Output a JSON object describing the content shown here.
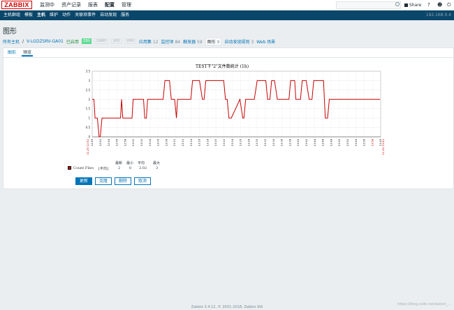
{
  "header": {
    "logo": "ZABBIX",
    "menu": [
      "监测中",
      "资产记录",
      "报表",
      "配置",
      "管理"
    ],
    "active_menu": "配置",
    "share_label": "Share",
    "help_icon": "?",
    "user_icon": "user-icon",
    "power_icon": "power-icon"
  },
  "subnav": {
    "items": [
      "主机群组",
      "模板",
      "主机",
      "维护",
      "动作",
      "关联项事件",
      "自动发现",
      "服务"
    ],
    "active": "主机",
    "ip": "192.168.0.4"
  },
  "page": {
    "title": "图形"
  },
  "breadcrumb": {
    "all_hosts": "所有主机",
    "sep": "/",
    "host": "V-LGDZSRV-GA01",
    "enabled": "已启用",
    "zbx": "ZBX",
    "snmp": "SNMP",
    "jmx": "JMX",
    "ipmi": "IPMI",
    "apps_label": "应用集",
    "apps_count": "12",
    "items_label": "监控项",
    "items_count": "84",
    "triggers_label": "触发器",
    "triggers_count": "59",
    "graphs_label": "图形",
    "graphs_count": "9",
    "discovery_label": "自动发现规则",
    "discovery_count": "3",
    "web_label": "Web 场景"
  },
  "tabs": {
    "graph": "图形",
    "preview": "预览"
  },
  "chart_data": {
    "type": "line",
    "title": "TEST下\"2\"文件数统计 (1h)",
    "ylim": [
      0,
      3.5
    ],
    "yticks": [
      "3.5",
      "3",
      "2.5",
      "2",
      "1.5",
      "1",
      "0.5",
      "0"
    ],
    "xticks": [
      "12:49",
      "12:52",
      "12:54",
      "12:56",
      "12:58",
      "13:00",
      "13:02",
      "13:04",
      "13:06",
      "13:08",
      "13:10",
      "13:12",
      "13:14",
      "13:16",
      "13:18",
      "13:20",
      "13:22",
      "13:24",
      "13:26",
      "13:28",
      "13:30",
      "13:32",
      "13:34",
      "13:36",
      "13:38",
      "13:40",
      "13:42",
      "13:44",
      "13:46",
      "13:48",
      "13:50",
      "13:52",
      "13:54",
      "13:56",
      "13:58",
      "13:49"
    ],
    "date_start": "11-29 12:52",
    "date_end": "11-29 13:52",
    "grid": true,
    "series": [
      {
        "name": "Count Files",
        "color": "#c80000",
        "x": [
          0,
          0.3,
          0.5,
          0.9,
          1.2,
          1.4,
          1.7,
          1.9,
          2.2,
          2.5,
          2.8,
          3.5,
          4.9,
          5.1,
          5.3,
          5.6,
          6.9,
          7.1,
          7.3,
          8.9,
          9.1,
          9.4,
          9.6,
          9.9,
          12.3,
          12.6,
          13.4,
          13.7,
          14.3,
          14.6,
          14.8,
          15.1,
          17.1,
          17.4,
          17.7,
          18.1,
          18.6,
          19.1,
          19.4,
          19.7,
          20.1,
          22.8,
          23.1,
          23.4,
          23.7,
          24.1,
          25.6,
          26.1,
          26.3,
          26.6,
          26.9,
          28.1,
          28.6,
          29.0,
          30.1,
          30.4,
          30.8,
          31.1,
          31.6,
          32.1,
          32.3,
          34.1,
          34.4,
          35.1,
          35.3,
          36.1,
          36.4,
          37.1,
          37.6,
          38.1,
          38.4,
          39.0,
          40.1,
          40.4,
          40.8,
          41.1,
          41.5,
          42.3,
          42.6,
          43.1,
          43.6,
          44.1,
          44.4,
          45.1,
          45.4,
          46.6,
          46.9,
          47.3,
          47.6,
          48.1,
          48.4,
          49.0,
          49.3,
          49.9
        ],
        "y": [
          2,
          2,
          1,
          1,
          0,
          0,
          1,
          1,
          1,
          1,
          1,
          1,
          1,
          2,
          1,
          1,
          1,
          2,
          2,
          2,
          1,
          1,
          2,
          2,
          2,
          3,
          3,
          2,
          2,
          1,
          2,
          2,
          2,
          3,
          3,
          3,
          3,
          2,
          2,
          3,
          3,
          3,
          2,
          2,
          1,
          1,
          2,
          1,
          1,
          2,
          2,
          2,
          3,
          3,
          3,
          2,
          2,
          3,
          3,
          2,
          2,
          2,
          3,
          3,
          2,
          2,
          3,
          3,
          2,
          2,
          3,
          3,
          3,
          1,
          1,
          2,
          2,
          2,
          2,
          2,
          2,
          2,
          2,
          2,
          2,
          2,
          2,
          2,
          2,
          2,
          2,
          2,
          2,
          2
        ]
      }
    ]
  },
  "legend": {
    "h_latest": "最新",
    "h_min": "最小",
    "h_avg": "平均",
    "h_max": "最大",
    "name": "Count Files",
    "func": "[平均]",
    "latest": "2",
    "min": "0",
    "avg": "2.02",
    "max": "3"
  },
  "buttons": {
    "update": "更新",
    "clone": "克隆",
    "delete": "删除",
    "cancel": "取消"
  },
  "footer": {
    "text": "Zabbix 3.4.12. © 2001–2018, Zabbix SIA",
    "watermark": "https://blog.csdn.net/weixin_..."
  }
}
